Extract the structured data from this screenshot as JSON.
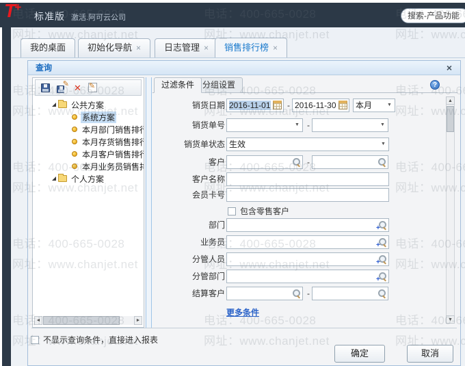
{
  "icons": {
    "close": "×",
    "tab_close": "×",
    "dropdown": "▼",
    "help": "?",
    "scroll_up": "▲",
    "scroll_down": "▼",
    "scroll_left": "◄",
    "scroll_right": "►",
    "delete": "✕",
    "pencil": "✎",
    "dash": "-"
  },
  "header": {
    "logo_t": "T",
    "logo_plus": "+",
    "edition": "标准版",
    "company": "激活.阿可云公司",
    "search_text": "搜索-产品功能"
  },
  "tabs": [
    {
      "label": "我的桌面",
      "closable": false,
      "active": false
    },
    {
      "label": "初始化导航",
      "closable": true,
      "active": false
    },
    {
      "label": "日志管理",
      "closable": true,
      "active": false
    },
    {
      "label": "销售排行榜",
      "closable": true,
      "active": true
    }
  ],
  "panel": {
    "title": "查询"
  },
  "tree": {
    "selected": "系统方案",
    "roots": [
      {
        "label": "公共方案",
        "children": [
          "系统方案",
          "本月部门销售排行",
          "本月存货销售排行",
          "本月客户销售排行",
          "本月业务员销售排"
        ]
      },
      {
        "label": "个人方案",
        "children": []
      }
    ]
  },
  "filter": {
    "tab_filter": "过滤条件",
    "tab_group": "分组设置",
    "sale_date": {
      "label": "销货日期",
      "from": "2016-11-01",
      "to": "2016-11-30",
      "period": "本月"
    },
    "sale_no": {
      "label": "销货单号",
      "from": "",
      "to": ""
    },
    "sale_status": {
      "label": "销货单状态",
      "value": "生效"
    },
    "customer": {
      "label": "客户",
      "from": "",
      "to": ""
    },
    "customer_name": {
      "label": "客户名称",
      "value": ""
    },
    "member_card": {
      "label": "会员卡号",
      "value": ""
    },
    "include_retail": {
      "label": "包含零售客户",
      "checked": false
    },
    "department": {
      "label": "部门",
      "value": ""
    },
    "salesman": {
      "label": "业务员",
      "value": ""
    },
    "manager": {
      "label": "分管人员",
      "value": ""
    },
    "manage_dept": {
      "label": "分管部门",
      "value": ""
    },
    "settle_customer": {
      "label": "结算客户",
      "from": "",
      "to": ""
    },
    "more_link": "更多条件"
  },
  "footer": {
    "hide_query": "不显示查询条件，直接进入报表",
    "ok": "确定",
    "cancel": "取消"
  },
  "watermark": {
    "phone": "电话：400-665-0028",
    "web": "网址：www.chanjet.net"
  }
}
